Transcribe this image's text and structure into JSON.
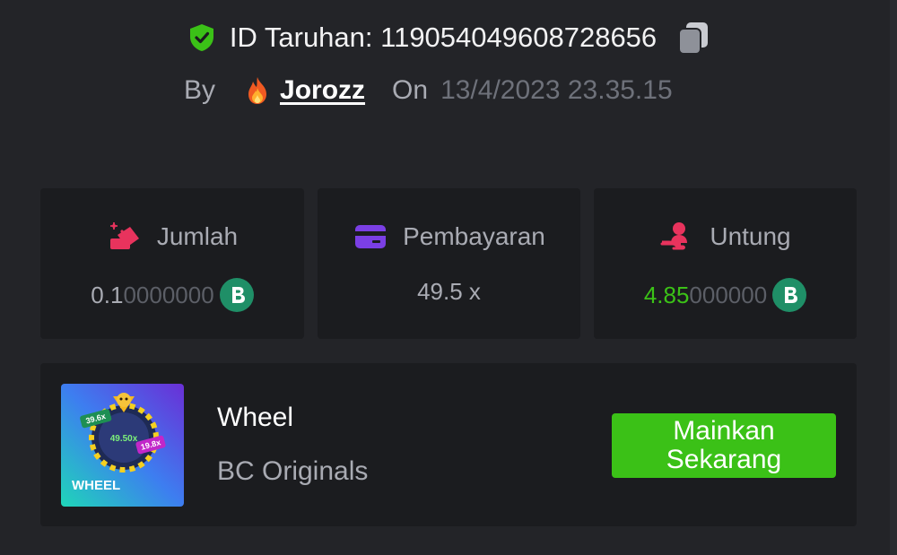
{
  "bet": {
    "id_label": "ID Taruhan: 119054049608728656",
    "by_label": "By",
    "username": "Jorozz",
    "on_label": "On",
    "date": "13/4/2023 23.35.15"
  },
  "stats": [
    {
      "label": "Jumlah",
      "value_main": "0.1",
      "value_dim": "0000000",
      "icon": "amount-icon",
      "currency_icon": "bc-coin-icon"
    },
    {
      "label": "Pembayaran",
      "value_main": "49.5 x",
      "value_dim": "",
      "icon": "card-icon"
    },
    {
      "label": "Untung",
      "value_main": "4.85",
      "value_dim": "000000",
      "icon": "profit-icon",
      "currency_icon": "bc-coin-icon"
    }
  ],
  "game": {
    "name": "Wheel",
    "provider": "BC Originals",
    "play_label": "Mainkan Sekarang",
    "thumb_title": "WHEEL",
    "thumb_badges": [
      "39.6x",
      "49.50x",
      "19.8x"
    ]
  },
  "colors": {
    "background": "#232428",
    "card": "#1b1c1f",
    "accent_green": "#3bc117",
    "muted_text": "#a9abb3"
  }
}
